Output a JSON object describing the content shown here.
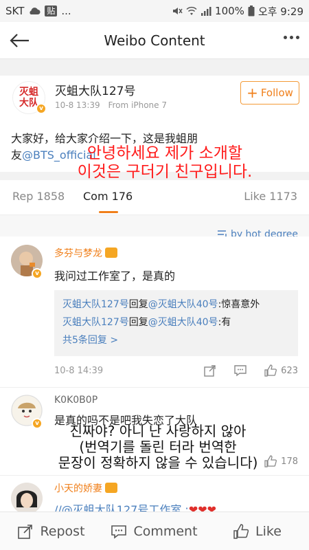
{
  "statusbar": {
    "carrier": "SKT",
    "app_badge": "贴",
    "dots": "...",
    "battery": "100%",
    "time": "오후 9:29"
  },
  "nav": {
    "title": "Weibo Content"
  },
  "post": {
    "author": "灭蛆大队127号",
    "avatar_text_line1": "灭蛆",
    "avatar_text_line2": "大队",
    "date": "10-8 13:39",
    "source": "From iPhone 7",
    "follow_label": "Follow",
    "body_line1": "大家好，给大家介绍一下，这是我蛆朋",
    "body_prefix2": "友",
    "body_mention": "@BTS_official",
    "overlay_line1": "안녕하세요 제가 소개할",
    "overlay_line2": "이것은 구더기 친구입니다."
  },
  "tabs": {
    "repost": "Rep 1858",
    "comment": "Com 176",
    "like": "Like 1173"
  },
  "sort": {
    "label": "by hot degree"
  },
  "comments": [
    {
      "name": "多芬与梦龙",
      "text": "我问过工作室了，是真的",
      "replies": [
        {
          "author": "灭蛆大队127号",
          "verb": "回复",
          "mention": "@灭蛆大队40号",
          "text": ":惊喜意外"
        },
        {
          "author": "灭蛆大队127号",
          "verb": "回复",
          "mention": "@灭蛆大队40号",
          "text": ":有"
        }
      ],
      "more_replies": "共5条回复 >",
      "date": "10-8 14:39",
      "likes": "623"
    },
    {
      "name": "K0K0B0P",
      "text": "是真的吗不是吧我失恋了大队",
      "overlay_line1": "진짜야? 아니 난 사랑하지 않아",
      "overlay_line2": "(번역기를 돌린 터라 번역한",
      "overlay_line3": "문장이 정확하지 않을 수 있습니다)",
      "likes": "178"
    },
    {
      "name": "小天的娇妻",
      "text": "//@灭蛆大队127号工作室 :"
    }
  ],
  "bottombar": {
    "repost": "Repost",
    "comment": "Comment",
    "like": "Like"
  }
}
